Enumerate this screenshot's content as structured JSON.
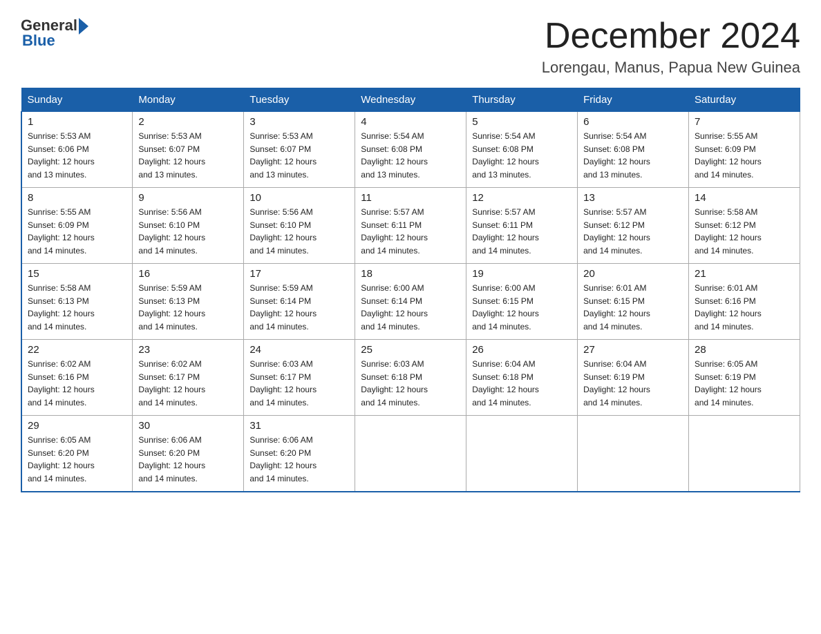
{
  "header": {
    "logo_general": "General",
    "logo_blue": "Blue",
    "month_title": "December 2024",
    "location": "Lorengau, Manus, Papua New Guinea"
  },
  "days_of_week": [
    "Sunday",
    "Monday",
    "Tuesday",
    "Wednesday",
    "Thursday",
    "Friday",
    "Saturday"
  ],
  "weeks": [
    [
      {
        "num": "1",
        "sunrise": "5:53 AM",
        "sunset": "6:06 PM",
        "daylight": "12 hours and 13 minutes."
      },
      {
        "num": "2",
        "sunrise": "5:53 AM",
        "sunset": "6:07 PM",
        "daylight": "12 hours and 13 minutes."
      },
      {
        "num": "3",
        "sunrise": "5:53 AM",
        "sunset": "6:07 PM",
        "daylight": "12 hours and 13 minutes."
      },
      {
        "num": "4",
        "sunrise": "5:54 AM",
        "sunset": "6:08 PM",
        "daylight": "12 hours and 13 minutes."
      },
      {
        "num": "5",
        "sunrise": "5:54 AM",
        "sunset": "6:08 PM",
        "daylight": "12 hours and 13 minutes."
      },
      {
        "num": "6",
        "sunrise": "5:54 AM",
        "sunset": "6:08 PM",
        "daylight": "12 hours and 13 minutes."
      },
      {
        "num": "7",
        "sunrise": "5:55 AM",
        "sunset": "6:09 PM",
        "daylight": "12 hours and 14 minutes."
      }
    ],
    [
      {
        "num": "8",
        "sunrise": "5:55 AM",
        "sunset": "6:09 PM",
        "daylight": "12 hours and 14 minutes."
      },
      {
        "num": "9",
        "sunrise": "5:56 AM",
        "sunset": "6:10 PM",
        "daylight": "12 hours and 14 minutes."
      },
      {
        "num": "10",
        "sunrise": "5:56 AM",
        "sunset": "6:10 PM",
        "daylight": "12 hours and 14 minutes."
      },
      {
        "num": "11",
        "sunrise": "5:57 AM",
        "sunset": "6:11 PM",
        "daylight": "12 hours and 14 minutes."
      },
      {
        "num": "12",
        "sunrise": "5:57 AM",
        "sunset": "6:11 PM",
        "daylight": "12 hours and 14 minutes."
      },
      {
        "num": "13",
        "sunrise": "5:57 AM",
        "sunset": "6:12 PM",
        "daylight": "12 hours and 14 minutes."
      },
      {
        "num": "14",
        "sunrise": "5:58 AM",
        "sunset": "6:12 PM",
        "daylight": "12 hours and 14 minutes."
      }
    ],
    [
      {
        "num": "15",
        "sunrise": "5:58 AM",
        "sunset": "6:13 PM",
        "daylight": "12 hours and 14 minutes."
      },
      {
        "num": "16",
        "sunrise": "5:59 AM",
        "sunset": "6:13 PM",
        "daylight": "12 hours and 14 minutes."
      },
      {
        "num": "17",
        "sunrise": "5:59 AM",
        "sunset": "6:14 PM",
        "daylight": "12 hours and 14 minutes."
      },
      {
        "num": "18",
        "sunrise": "6:00 AM",
        "sunset": "6:14 PM",
        "daylight": "12 hours and 14 minutes."
      },
      {
        "num": "19",
        "sunrise": "6:00 AM",
        "sunset": "6:15 PM",
        "daylight": "12 hours and 14 minutes."
      },
      {
        "num": "20",
        "sunrise": "6:01 AM",
        "sunset": "6:15 PM",
        "daylight": "12 hours and 14 minutes."
      },
      {
        "num": "21",
        "sunrise": "6:01 AM",
        "sunset": "6:16 PM",
        "daylight": "12 hours and 14 minutes."
      }
    ],
    [
      {
        "num": "22",
        "sunrise": "6:02 AM",
        "sunset": "6:16 PM",
        "daylight": "12 hours and 14 minutes."
      },
      {
        "num": "23",
        "sunrise": "6:02 AM",
        "sunset": "6:17 PM",
        "daylight": "12 hours and 14 minutes."
      },
      {
        "num": "24",
        "sunrise": "6:03 AM",
        "sunset": "6:17 PM",
        "daylight": "12 hours and 14 minutes."
      },
      {
        "num": "25",
        "sunrise": "6:03 AM",
        "sunset": "6:18 PM",
        "daylight": "12 hours and 14 minutes."
      },
      {
        "num": "26",
        "sunrise": "6:04 AM",
        "sunset": "6:18 PM",
        "daylight": "12 hours and 14 minutes."
      },
      {
        "num": "27",
        "sunrise": "6:04 AM",
        "sunset": "6:19 PM",
        "daylight": "12 hours and 14 minutes."
      },
      {
        "num": "28",
        "sunrise": "6:05 AM",
        "sunset": "6:19 PM",
        "daylight": "12 hours and 14 minutes."
      }
    ],
    [
      {
        "num": "29",
        "sunrise": "6:05 AM",
        "sunset": "6:20 PM",
        "daylight": "12 hours and 14 minutes."
      },
      {
        "num": "30",
        "sunrise": "6:06 AM",
        "sunset": "6:20 PM",
        "daylight": "12 hours and 14 minutes."
      },
      {
        "num": "31",
        "sunrise": "6:06 AM",
        "sunset": "6:20 PM",
        "daylight": "12 hours and 14 minutes."
      },
      null,
      null,
      null,
      null
    ]
  ]
}
